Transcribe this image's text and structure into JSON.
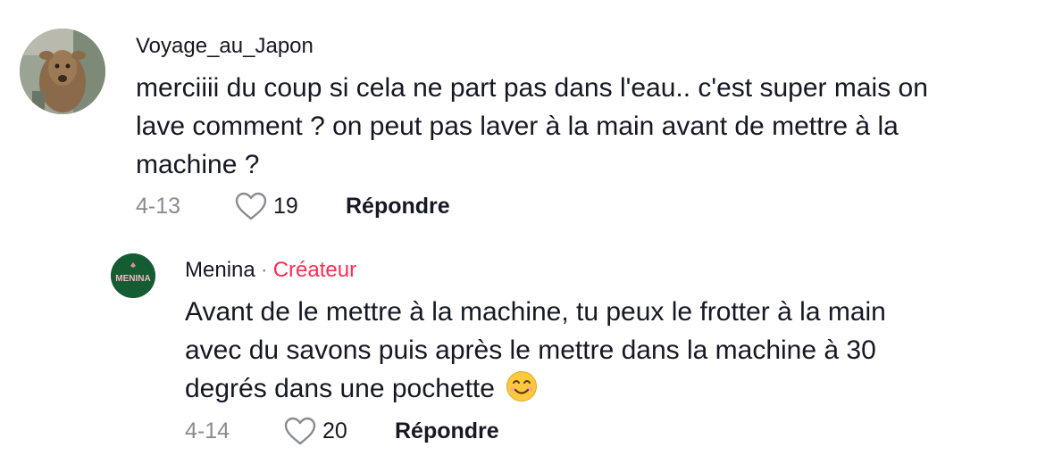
{
  "comments": [
    {
      "username": "Voyage_au_Japon",
      "text_lines": [
        "merciiii du coup si cela ne part pas dans l'eau.. c'est super mais on",
        "lave comment ? on peut pas laver à la main avant de mettre à la",
        "machine ?"
      ],
      "date": "4-13",
      "likes": "19",
      "reply_label": "Répondre",
      "avatar_icon": "deer-photo-avatar"
    },
    {
      "username": "Menina",
      "separator": "·",
      "badge": "Créateur",
      "text_lines": [
        "Avant de le mettre à la machine, tu peux le frotter à la main",
        "avec du savons puis après le mettre dans la machine à 30",
        "degrés dans une pochette"
      ],
      "emoji": "😊",
      "date": "4-14",
      "likes": "20",
      "reply_label": "Répondre",
      "avatar_icon": "menina-logo-avatar",
      "avatar_text": "MENINA"
    }
  ],
  "colors": {
    "text": "#161823",
    "muted": "#8a8b91",
    "creator_badge": "#fe2c55",
    "menina_green": "#165c33"
  }
}
